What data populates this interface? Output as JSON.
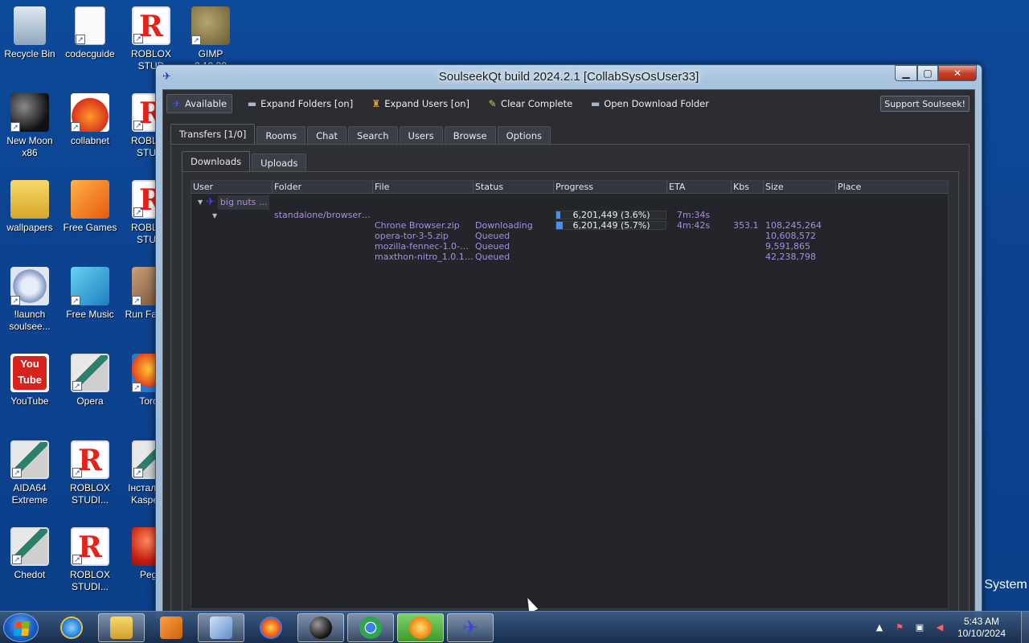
{
  "desktop": {
    "icons": [
      {
        "label": "Recycle Bin",
        "icon": "recycle-bin-icon"
      },
      {
        "label": "codecguide",
        "icon": "document-icon"
      },
      {
        "label": "ROBLOX STUD",
        "icon": "roblox-icon"
      },
      {
        "label": "GIMP 2.10.38",
        "icon": "gimp-icon"
      },
      {
        "label": "New Moon x86",
        "icon": "new-moon-icon"
      },
      {
        "label": "collabnet",
        "icon": "collabnet-icon"
      },
      {
        "label": "ROBLOX STUDI",
        "icon": "roblox-icon"
      },
      {
        "label": "wallpapers",
        "icon": "folder-icon"
      },
      {
        "label": "Free Games",
        "icon": "free-games-icon"
      },
      {
        "label": "ROBLOX STUDI",
        "icon": "roblox-icon"
      },
      {
        "label": "!launch soulsee...",
        "icon": "gear-icon"
      },
      {
        "label": "Free Music",
        "icon": "music-icon"
      },
      {
        "label": "Run Fa Guy",
        "icon": "run-fast-icon"
      },
      {
        "label": "YouTube",
        "icon": "youtube-icon"
      },
      {
        "label": "Opera",
        "icon": "app-icon"
      },
      {
        "label": "Torch",
        "icon": "torch-icon"
      },
      {
        "label": "AIDA64 Extreme",
        "icon": "app-icon"
      },
      {
        "label": "ROBLOX STUDI...",
        "icon": "roblox-icon"
      },
      {
        "label": "Інсталяція Kaspersk",
        "icon": "app-icon"
      },
      {
        "label": "Chedot",
        "icon": "app-icon"
      },
      {
        "label": "ROBLOX STUDI...",
        "icon": "roblox-icon"
      },
      {
        "label": "Pego",
        "icon": "pego-icon"
      }
    ],
    "watermark": "g System"
  },
  "window": {
    "title": "SoulseekQt build 2024.2.1 [CollabSysOsUser33]",
    "toolbar": {
      "available": "Available",
      "expand_folders": "Expand Folders [on]",
      "expand_users": "Expand Users [on]",
      "clear_complete": "Clear Complete",
      "open_download_folder": "Open Download Folder",
      "support": "Support Soulseek!"
    },
    "tabs": [
      "Transfers [1/0]",
      "Rooms",
      "Chat",
      "Search",
      "Users",
      "Browse",
      "Options"
    ],
    "subtabs": [
      "Downloads",
      "Uploads"
    ],
    "columns": [
      "User",
      "Folder",
      "File",
      "Status",
      "Progress",
      "ETA",
      "Kbs",
      "Size",
      "Place"
    ],
    "user": {
      "name": "big nuts ..."
    },
    "folder_row": {
      "folder": "standalone/browser c...",
      "progress_text": "6,201,449 (3.6%)",
      "progress": 3.6,
      "eta": "7m:34s"
    },
    "files": [
      {
        "file": "Chrone Browser.zip",
        "status": "Downloading",
        "progress_text": "6,201,449 (5.7%)",
        "progress": 5.7,
        "eta": "4m:42s",
        "kbs": "353.1",
        "size": "108,245,264"
      },
      {
        "file": "opera-tor-3-5.zip",
        "status": "Queued",
        "size": "10,608,572"
      },
      {
        "file": "mozilla-fennec-1.0-bet...",
        "status": "Queued",
        "size": "9,591,865"
      },
      {
        "file": "maxthon-nitro_1.0.1....",
        "status": "Queued",
        "size": "42,238,798"
      }
    ]
  },
  "taskbar": {
    "time": "5:43 AM",
    "date": "10/10/2024",
    "apps": [
      "internet-explorer-icon",
      "file-explorer-icon",
      "media-player-icon",
      "control-panel-icon",
      "collabnet-icon",
      "new-moon-icon",
      "chrome-icon",
      "torch-icon",
      "soulseek-icon"
    ]
  }
}
